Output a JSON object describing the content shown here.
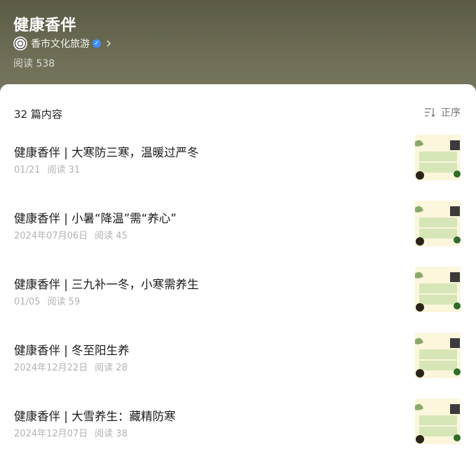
{
  "header": {
    "title": "健康香伴",
    "account_name": "香市文化旅游",
    "read_count": "阅读 538"
  },
  "list": {
    "count_label": "32 篇内容",
    "sort_label": "正序",
    "items": [
      {
        "title": "健康香伴 | 大寒防三寒，温暖过严冬",
        "date": "01/21",
        "reads": "阅读 31"
      },
      {
        "title": "健康香伴 | 小暑“降温”需“养心”",
        "date": "2024年07月06日",
        "reads": "阅读 45"
      },
      {
        "title": "健康香伴 | 三九补一冬，小寒需养生",
        "date": "01/05",
        "reads": "阅读 59"
      },
      {
        "title": "健康香伴 | 冬至阳生养",
        "date": "2024年12月22日",
        "reads": "阅读 28"
      },
      {
        "title": "健康香伴 | 大雪养生：藏精防寒",
        "date": "2024年12月07日",
        "reads": "阅读 38"
      }
    ]
  },
  "icons": {
    "verified": "verified-badge-icon",
    "chevron": "chevron-right-icon",
    "sort": "sort-icon"
  },
  "colors": {
    "header_bg": "#6b6a52",
    "verified": "#3d8fff",
    "thumb_text": "#3a8a2a"
  }
}
